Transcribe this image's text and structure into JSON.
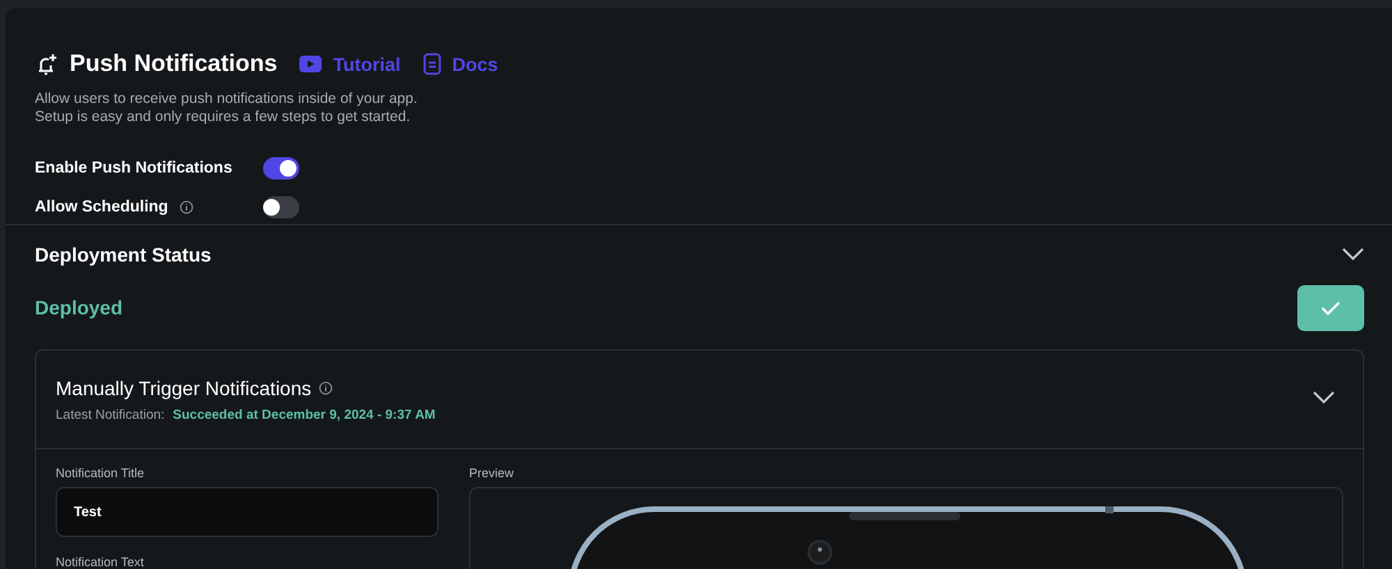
{
  "header": {
    "title": "Push Notifications",
    "links": [
      {
        "label": "Tutorial",
        "kind": "video"
      },
      {
        "label": "Docs",
        "kind": "docs"
      }
    ],
    "description": [
      "Allow users to receive push notifications inside of your app.",
      "Setup is easy and only requires a few steps to get started."
    ]
  },
  "settings": [
    {
      "label": "Enable Push Notifications",
      "on": true,
      "info": false
    },
    {
      "label": "Allow Scheduling",
      "on": false,
      "info": true
    }
  ],
  "deployment": {
    "title": "Deployment Status",
    "expanded": false,
    "status": "Deployed"
  },
  "trigger_card": {
    "title": "Manually Trigger Notifications",
    "expanded": false,
    "latest_label": "Latest Notification:",
    "latest_value": "Succeeded at December 9, 2024 - 9:37 AM",
    "fields": [
      {
        "label": "Notification Title",
        "value": "Test"
      },
      {
        "label": "Notification Text"
      }
    ],
    "preview_label": "Preview"
  }
}
